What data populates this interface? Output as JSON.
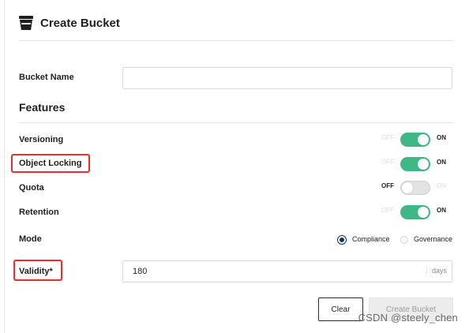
{
  "header": {
    "title": "Create Bucket",
    "icon": "bucket-icon"
  },
  "form": {
    "bucket_name": {
      "label": "Bucket Name",
      "value": "",
      "placeholder": ""
    },
    "features_heading": "Features",
    "toggles": [
      {
        "label": "Versioning",
        "state": "on",
        "off_text": "OFF",
        "on_text": "ON"
      },
      {
        "label": "Object Locking",
        "state": "on",
        "off_text": "OFF",
        "on_text": "ON"
      },
      {
        "label": "Quota",
        "state": "off",
        "off_text": "OFF",
        "on_text": "ON"
      },
      {
        "label": "Retention",
        "state": "on",
        "off_text": "OFF",
        "on_text": "ON"
      }
    ],
    "mode": {
      "label": "Mode",
      "options": [
        "Compliance",
        "Governance"
      ],
      "selected": "Compliance"
    },
    "validity": {
      "label": "Validity*",
      "value": "180",
      "unit": "days"
    }
  },
  "buttons": {
    "clear": "Clear",
    "create": "Create Bucket"
  },
  "watermark": "CSDN @steely_chen",
  "colors": {
    "toggle_on": "#3fb885",
    "radio_selected": "#0f3557",
    "highlight": "#e0322b"
  }
}
